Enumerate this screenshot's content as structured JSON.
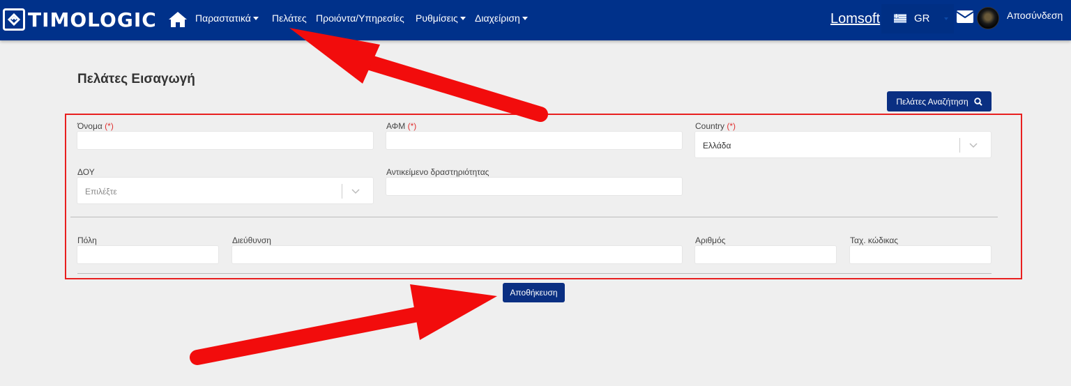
{
  "navbar": {
    "brand": "TIMOLOGIC",
    "menu": [
      {
        "label": "Παραστατικά",
        "dropdown": true
      },
      {
        "label": "Πελάτες",
        "dropdown": false
      },
      {
        "label": "Προιόντα/Υπηρεσίες",
        "dropdown": false
      },
      {
        "label": "Ρυθμίσεις",
        "dropdown": true
      },
      {
        "label": "Διαχείριση",
        "dropdown": true
      }
    ],
    "company_link": "Lomsoft",
    "language": "GR",
    "logout": "Αποσύνδεση"
  },
  "page": {
    "title": "Πελάτες Εισαγωγή",
    "search_button": "Πελάτες Αναζήτηση",
    "save_button": "Αποθήκευση"
  },
  "form": {
    "required_marker": "(*)",
    "name_label": "Όνομα",
    "afm_label": "ΑΦΜ",
    "country_label": "Country",
    "country_value": "Ελλάδα",
    "doy_label": "ΔΟΥ",
    "doy_placeholder": "Επιλέξτε",
    "activity_label": "Αντικείμενο δραστηριότητας",
    "city_label": "Πόλη",
    "address_label": "Διεύθυνση",
    "number_label": "Αριθμός",
    "postal_label": "Ταχ. κώδικας"
  },
  "colors": {
    "navbar": "#00318a",
    "primary_button": "#0a2f82",
    "highlight": "#e81f1f",
    "annotation_arrow": "#f20c0c"
  }
}
